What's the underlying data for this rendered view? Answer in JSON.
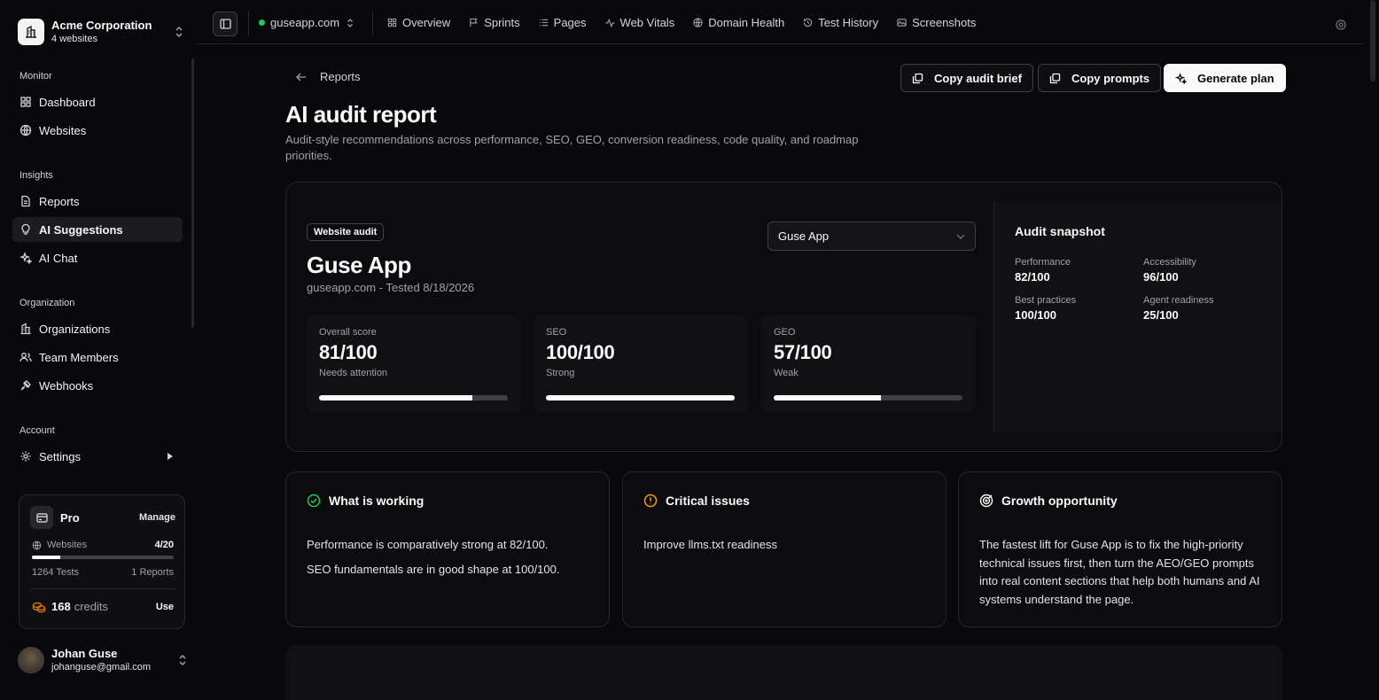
{
  "org": {
    "name": "Acme Corporation",
    "sub": "4 websites"
  },
  "nav": {
    "monitor_label": "Monitor",
    "insights_label": "Insights",
    "organization_label": "Organization",
    "account_label": "Account",
    "items": [
      {
        "label": "Dashboard",
        "icon": "grid-icon"
      },
      {
        "label": "Websites",
        "icon": "globe-icon"
      },
      {
        "label": "Reports",
        "icon": "file-icon"
      },
      {
        "label": "AI Suggestions",
        "icon": "lightbulb-icon",
        "active": true
      },
      {
        "label": "AI Chat",
        "icon": "sparkles-icon"
      },
      {
        "label": "Organizations",
        "icon": "building-icon"
      },
      {
        "label": "Team Members",
        "icon": "users-icon"
      },
      {
        "label": "Webhooks",
        "icon": "webhook-icon"
      },
      {
        "label": "Settings",
        "icon": "gear-icon"
      }
    ]
  },
  "plan": {
    "name": "Pro",
    "manage": "Manage",
    "websites_label": "Websites",
    "websites_value": "4/20",
    "websites_fraction": 0.2,
    "tests": "1264 Tests",
    "reports": "1 Reports",
    "credits": "168",
    "credits_unit": "credits",
    "use": "Use"
  },
  "user": {
    "name": "Johan Guse",
    "email": "johanguse@gmail.com"
  },
  "topbar": {
    "site": "guseapp.com",
    "tabs": [
      {
        "label": "Overview",
        "icon": "grid-icon"
      },
      {
        "label": "Sprints",
        "icon": "flag-icon"
      },
      {
        "label": "Pages",
        "icon": "list-icon"
      },
      {
        "label": "Web Vitals",
        "icon": "activity-icon"
      },
      {
        "label": "Domain Health",
        "icon": "globe-icon"
      },
      {
        "label": "Test History",
        "icon": "history-icon"
      },
      {
        "label": "Screenshots",
        "icon": "image-icon"
      }
    ]
  },
  "page": {
    "back": "Reports",
    "title": "AI audit report",
    "description": "Audit-style recommendations across performance, SEO, GEO, conversion readiness, code quality, and roadmap priorities.",
    "buttons": {
      "copy_brief": "Copy audit brief",
      "copy_prompts": "Copy prompts",
      "generate": "Generate plan"
    }
  },
  "audit": {
    "badge": "Website audit",
    "selected_site": "Guse App",
    "site_name": "Guse App",
    "meta": "guseapp.com - Tested 8/18/2026",
    "scores": [
      {
        "label": "Overall score",
        "value": "81/100",
        "status": "Needs attention",
        "fraction": 0.81
      },
      {
        "label": "SEO",
        "value": "100/100",
        "status": "Strong",
        "fraction": 1.0
      },
      {
        "label": "GEO",
        "value": "57/100",
        "status": "Weak",
        "fraction": 0.57
      }
    ],
    "snapshot": {
      "title": "Audit snapshot",
      "items": [
        {
          "label": "Performance",
          "value": "82/100"
        },
        {
          "label": "Accessibility",
          "value": "96/100"
        },
        {
          "label": "Best practices",
          "value": "100/100"
        },
        {
          "label": "Agent readiness",
          "value": "25/100"
        }
      ]
    }
  },
  "cards": {
    "working": {
      "title": "What is working",
      "lines": [
        "Performance is comparatively strong at 82/100.",
        "SEO fundamentals are in good shape at 100/100."
      ]
    },
    "critical": {
      "title": "Critical issues",
      "lines": [
        "Improve llms.txt readiness"
      ]
    },
    "growth": {
      "title": "Growth opportunity",
      "lines": [
        "The fastest lift for Guse App is to fix the high-priority technical issues first, then turn the AEO/GEO prompts into real content sections that help both humans and AI systems understand the page."
      ]
    }
  },
  "colors": {
    "success": "#22c55e",
    "warning": "#f59e0b",
    "coin": "#d97706"
  }
}
